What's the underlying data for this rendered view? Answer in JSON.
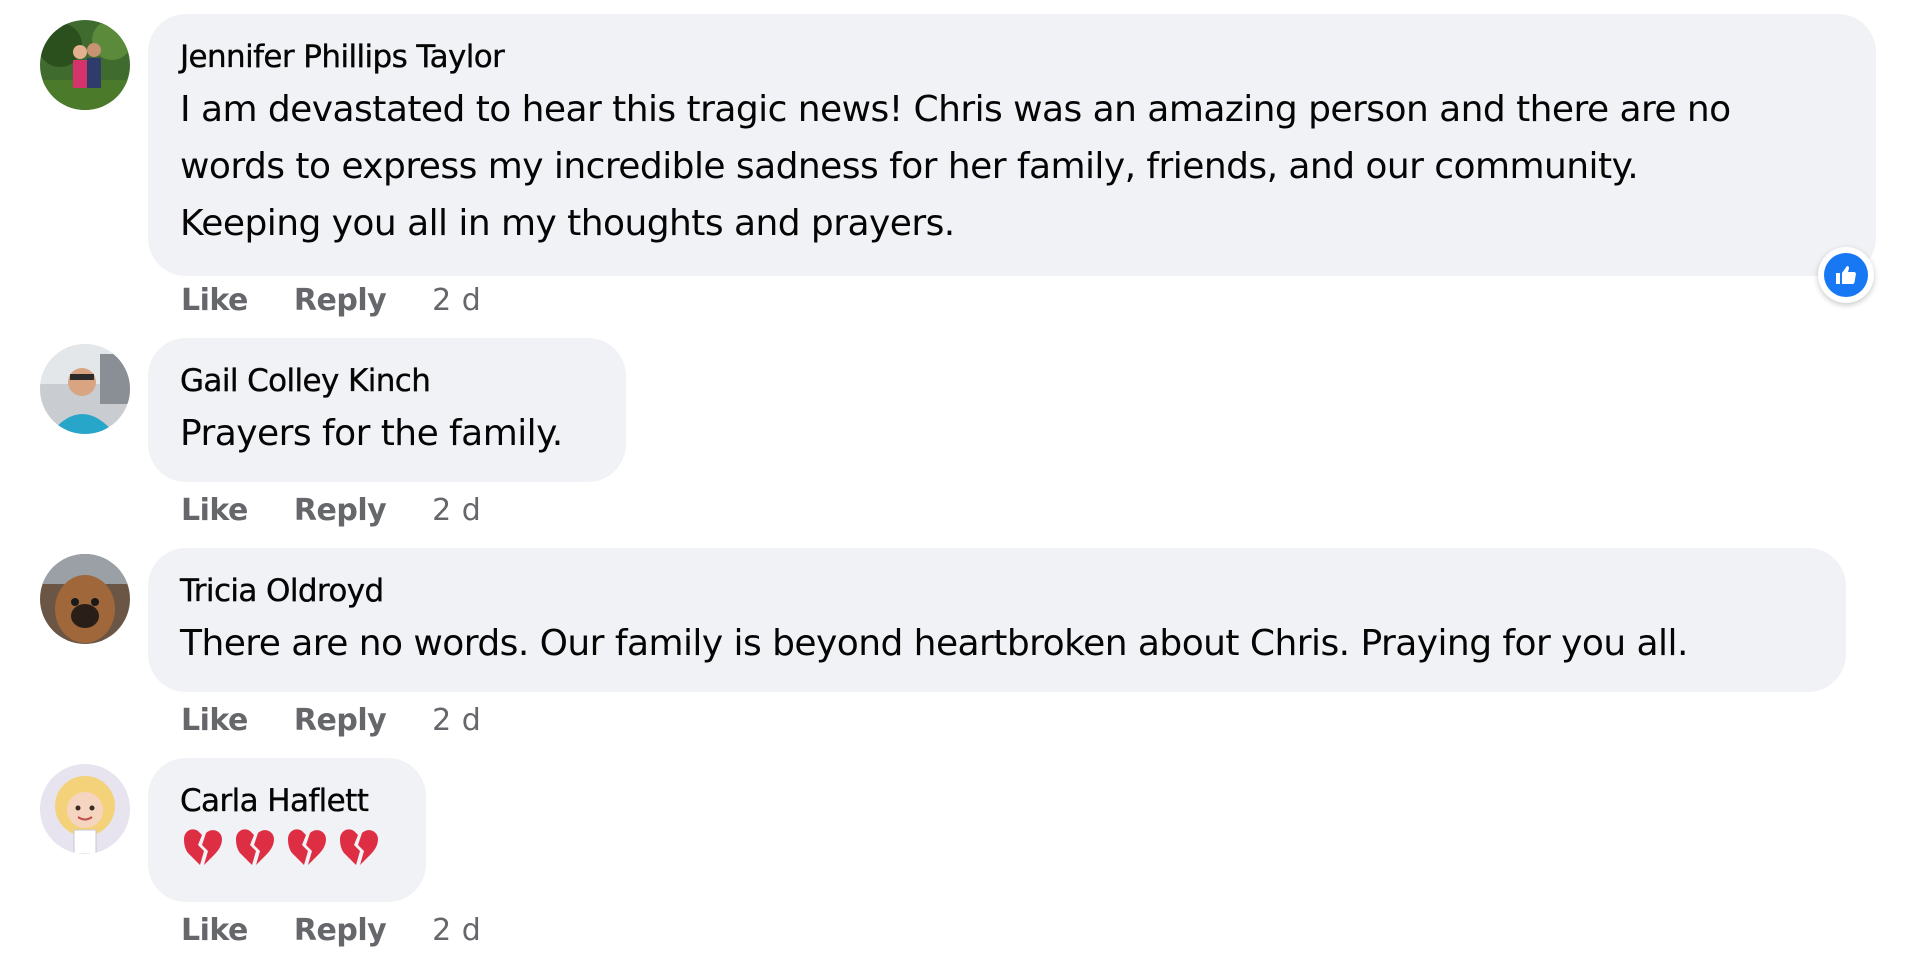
{
  "comments": [
    {
      "author": "Jennifer Phillips Taylor",
      "text": "I am devastated to hear this tragic news! Chris was an amazing person and there are no\nwords to express my incredible sadness for her family, friends, and our community.\nKeeping you all in my thoughts and prayers.",
      "like_label": "Like",
      "reply_label": "Reply",
      "time": "2 d",
      "reaction": "like-icon"
    },
    {
      "author": "Gail Colley Kinch",
      "text": "Prayers for the family.",
      "like_label": "Like",
      "reply_label": "Reply",
      "time": "2 d"
    },
    {
      "author": "Tricia Oldroyd",
      "text": "There are no words. Our family is beyond heartbroken about Chris. Praying for you all.",
      "like_label": "Like",
      "reply_label": "Reply",
      "time": "2 d"
    },
    {
      "author": "Carla Haflett",
      "text": "💔💔💔💔",
      "like_label": "Like",
      "reply_label": "Reply",
      "time": "2 d"
    }
  ],
  "colors": {
    "bubble": "#f0f2f5",
    "meta_text": "#65676b",
    "like_blue": "#1877f2"
  }
}
